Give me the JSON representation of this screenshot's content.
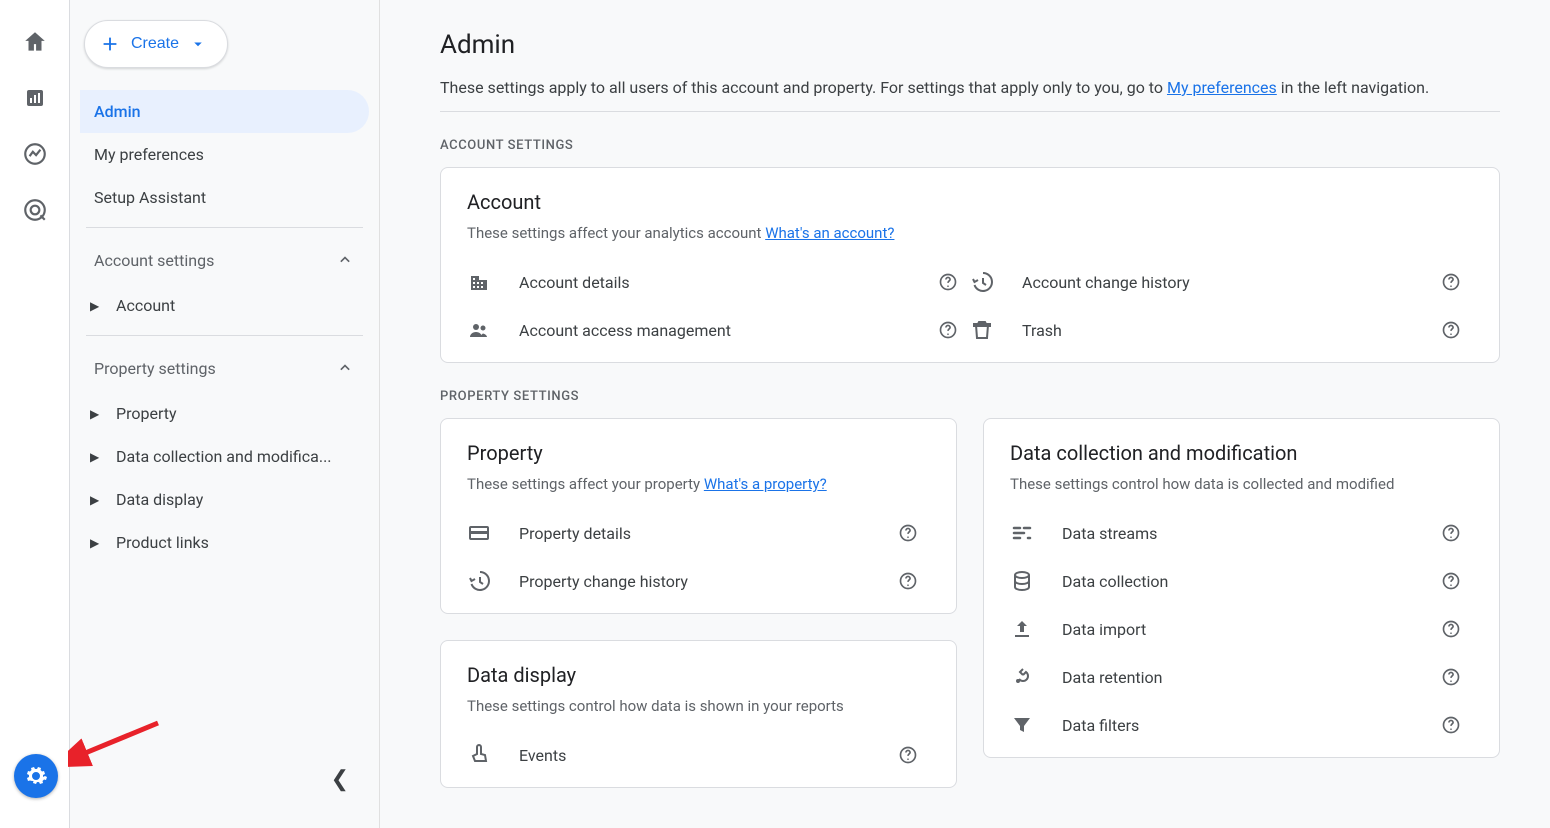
{
  "create_label": "Create",
  "sidebar": {
    "main_nav": [
      {
        "label": "Admin",
        "active": true
      },
      {
        "label": "My preferences"
      },
      {
        "label": "Setup Assistant"
      }
    ],
    "section1": {
      "title": "Account settings",
      "items": [
        {
          "label": "Account"
        }
      ]
    },
    "section2": {
      "title": "Property settings",
      "items": [
        {
          "label": "Property"
        },
        {
          "label": "Data collection and modifica..."
        },
        {
          "label": "Data display"
        },
        {
          "label": "Product links"
        }
      ]
    }
  },
  "page": {
    "title": "Admin",
    "subtitle_pre": "These settings apply to all users of this account and property. For settings that apply only to you, go to ",
    "subtitle_link": "My preferences",
    "subtitle_post": " in the left navigation."
  },
  "account_section_label": "ACCOUNT SETTINGS",
  "property_section_label": "PROPERTY SETTINGS",
  "account_card": {
    "title": "Account",
    "desc_pre": "These settings affect your analytics account ",
    "desc_link": "What's an account?",
    "links": [
      {
        "icon": "building",
        "label": "Account details"
      },
      {
        "icon": "history",
        "label": "Account change history"
      },
      {
        "icon": "people",
        "label": "Account access management"
      },
      {
        "icon": "trash",
        "label": "Trash"
      }
    ]
  },
  "property_card": {
    "title": "Property",
    "desc_pre": "These settings affect your property ",
    "desc_link": "What's a property?",
    "links": [
      {
        "icon": "card",
        "label": "Property details"
      },
      {
        "icon": "history",
        "label": "Property change history"
      }
    ]
  },
  "data_collection_card": {
    "title": "Data collection and modification",
    "desc": "These settings control how data is collected and modified",
    "links": [
      {
        "icon": "streams",
        "label": "Data streams"
      },
      {
        "icon": "db",
        "label": "Data collection"
      },
      {
        "icon": "upload",
        "label": "Data import"
      },
      {
        "icon": "retention",
        "label": "Data retention"
      },
      {
        "icon": "filter",
        "label": "Data filters"
      }
    ]
  },
  "data_display_card": {
    "title": "Data display",
    "desc": "These settings control how data is shown in your reports",
    "links": [
      {
        "icon": "touch",
        "label": "Events"
      }
    ]
  }
}
